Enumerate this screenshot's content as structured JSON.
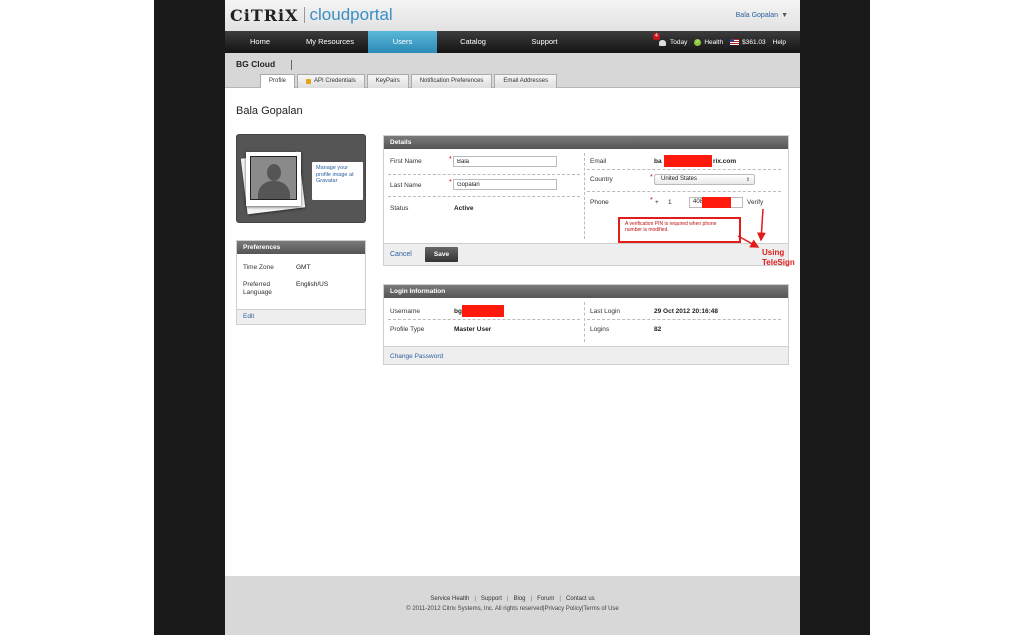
{
  "header": {
    "brand": "CiTRiX",
    "product": "cloudportal",
    "user_menu": "Bala Gopalan"
  },
  "nav": {
    "items": [
      "Home",
      "My Resources",
      "Users",
      "Catalog",
      "Support"
    ],
    "active": "Users",
    "alerts_count": "4",
    "today_label": "Today",
    "health_label": "Health",
    "balance": "$361.03",
    "help_label": "Help"
  },
  "account": {
    "name": "BG Cloud",
    "tabs": [
      "Profile",
      "API Credentials",
      "KeyPairs",
      "Notification Preferences",
      "Email Addresses"
    ],
    "active_tab": "Profile"
  },
  "page_title": "Bala Gopalan",
  "avatar": {
    "gravatar_text": "Manage your profile image at Gravatar"
  },
  "preferences": {
    "title": "Preferences",
    "time_zone_label": "Time Zone",
    "time_zone_value": "GMT",
    "language_label": "Preferred Language",
    "language_value": "English/US",
    "edit_label": "Edit"
  },
  "details": {
    "title": "Details",
    "first_name_label": "First Name",
    "first_name_value": "Bala",
    "last_name_label": "Last Name",
    "last_name_value": "Gopalan",
    "status_label": "Status",
    "status_value": "Active",
    "email_label": "Email",
    "email_prefix": "ba",
    "email_suffix": "rix.com",
    "country_label": "Country",
    "country_value": "United States",
    "phone_label": "Phone",
    "phone_plus": "+",
    "phone_country_code": "1",
    "phone_prefix": "408",
    "verify_label": "Verify",
    "cancel_label": "Cancel",
    "save_label": "Save"
  },
  "annotation": {
    "callout": "A verification PIN is required when phone number is modified.",
    "note_line1": "Using",
    "note_line2": "TeleSign",
    "color": "#e21b1b"
  },
  "login_info": {
    "title": "Login Information",
    "username_label": "Username",
    "username_prefix": "bg",
    "profile_type_label": "Profile Type",
    "profile_type_value": "Master User",
    "last_login_label": "Last Login",
    "last_login_value": "29 Oct 2012 20:16:48",
    "logins_label": "Logins",
    "logins_value": "82",
    "change_password_label": "Change Password"
  },
  "footer": {
    "links": [
      "Service Health",
      "Support",
      "Blog",
      "Forum",
      "Contact us"
    ],
    "copyright": "© 2011-2012 Citrix Systems, Inc. All rights reserved",
    "privacy_label": "Privacy Policy",
    "terms_label": "Terms of Use"
  },
  "colors": {
    "accent": "#3a8fc4",
    "nav_active": "#2d8ab5",
    "link": "#2a5f9e",
    "redaction": "#ff1a0d"
  }
}
